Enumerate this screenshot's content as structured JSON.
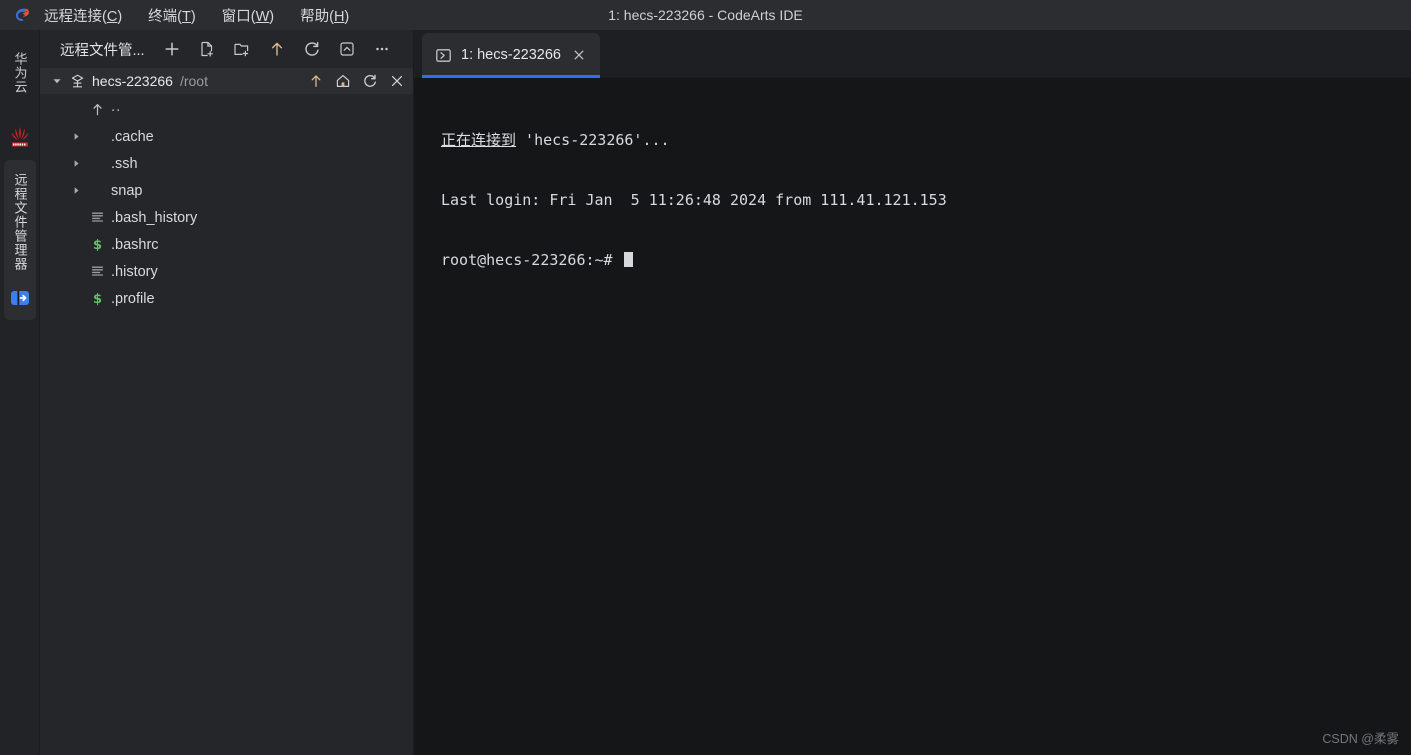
{
  "window": {
    "title": "1: hecs-223266 - CodeArts IDE",
    "logo_icon": "codearts-logo-icon"
  },
  "menubar": {
    "items": [
      {
        "label": "远程连接(C)",
        "text": "远程连接(",
        "mnemonic": "C",
        "tail": ")"
      },
      {
        "label": "终端(T)",
        "text": "终端(",
        "mnemonic": "T",
        "tail": ")"
      },
      {
        "label": "窗口(W)",
        "text": "窗口(",
        "mnemonic": "W",
        "tail": ")"
      },
      {
        "label": "帮助(H)",
        "text": "帮助(",
        "mnemonic": "H",
        "tail": ")"
      }
    ]
  },
  "activitybar": {
    "brand_label": "华为云",
    "brand_logo_icon": "huawei-logo-icon",
    "active_group_label": "远程文件管理器",
    "remote_connect_icon": "remote-connect-icon"
  },
  "file_panel": {
    "title": "远程文件管...",
    "toolbar": [
      {
        "name": "new-connection-button",
        "icon": "plus-icon"
      },
      {
        "name": "new-file-button",
        "icon": "new-file-icon"
      },
      {
        "name": "new-folder-button",
        "icon": "new-folder-icon"
      },
      {
        "name": "upload-button",
        "icon": "arrow-up-icon"
      },
      {
        "name": "refresh-button",
        "icon": "refresh-icon"
      },
      {
        "name": "collapse-all-button",
        "icon": "collapse-all-icon"
      },
      {
        "name": "more-actions-button",
        "icon": "more-horizontal-icon"
      }
    ],
    "host": {
      "twisty": "chevron-down-icon",
      "icon": "server-icon",
      "name": "hecs-223266",
      "path": "/root",
      "tools": [
        {
          "name": "go-up-button",
          "icon": "arrow-up-icon"
        },
        {
          "name": "go-home-button",
          "icon": "home-icon"
        },
        {
          "name": "refresh-host-button",
          "icon": "refresh-icon"
        },
        {
          "name": "close-host-button",
          "icon": "close-icon"
        }
      ]
    },
    "tree": [
      {
        "label": "..",
        "type": "parent",
        "icon": "arrow-up-icon",
        "arrow": "none"
      },
      {
        "label": ".cache",
        "type": "folder",
        "icon": "none",
        "arrow": "chevron-right-icon"
      },
      {
        "label": ".ssh",
        "type": "folder",
        "icon": "none",
        "arrow": "chevron-right-icon"
      },
      {
        "label": "snap",
        "type": "folder",
        "icon": "none",
        "arrow": "chevron-right-icon"
      },
      {
        "label": ".bash_history",
        "type": "file",
        "icon": "text-file-icon",
        "arrow": "none"
      },
      {
        "label": ".bashrc",
        "type": "file",
        "icon": "shell-file-icon",
        "arrow": "none"
      },
      {
        "label": ".history",
        "type": "file",
        "icon": "text-file-icon",
        "arrow": "none"
      },
      {
        "label": ".profile",
        "type": "file",
        "icon": "shell-file-icon",
        "arrow": "none"
      }
    ]
  },
  "editor": {
    "tabs": [
      {
        "label": "1: hecs-223266",
        "icon": "terminal-icon",
        "close_icon": "close-icon",
        "active": true
      }
    ]
  },
  "terminal": {
    "lines": [
      {
        "prefix": "正在连接到",
        "prefix_underline": true,
        "rest": " 'hecs-223266'..."
      },
      {
        "prefix": "",
        "prefix_underline": false,
        "rest": "Last login: Fri Jan  5 11:26:48 2024 from 111.41.121.153"
      },
      {
        "prefix": "",
        "prefix_underline": false,
        "rest": "root@hecs-223266:~# ",
        "cursor": true
      }
    ]
  },
  "watermark": "CSDN @柔雾",
  "colors": {
    "titlebar_bg": "#2b2d30",
    "activitybar_bg": "#222326",
    "panel_bg": "#252629",
    "terminal_bg": "#151618",
    "tab_active_bg": "#2b2d30",
    "tab_accent": "#2f6feb",
    "shell_icon_green": "#61c261",
    "text_primary": "#d8d9dc",
    "text_muted": "#9a9ba0"
  }
}
